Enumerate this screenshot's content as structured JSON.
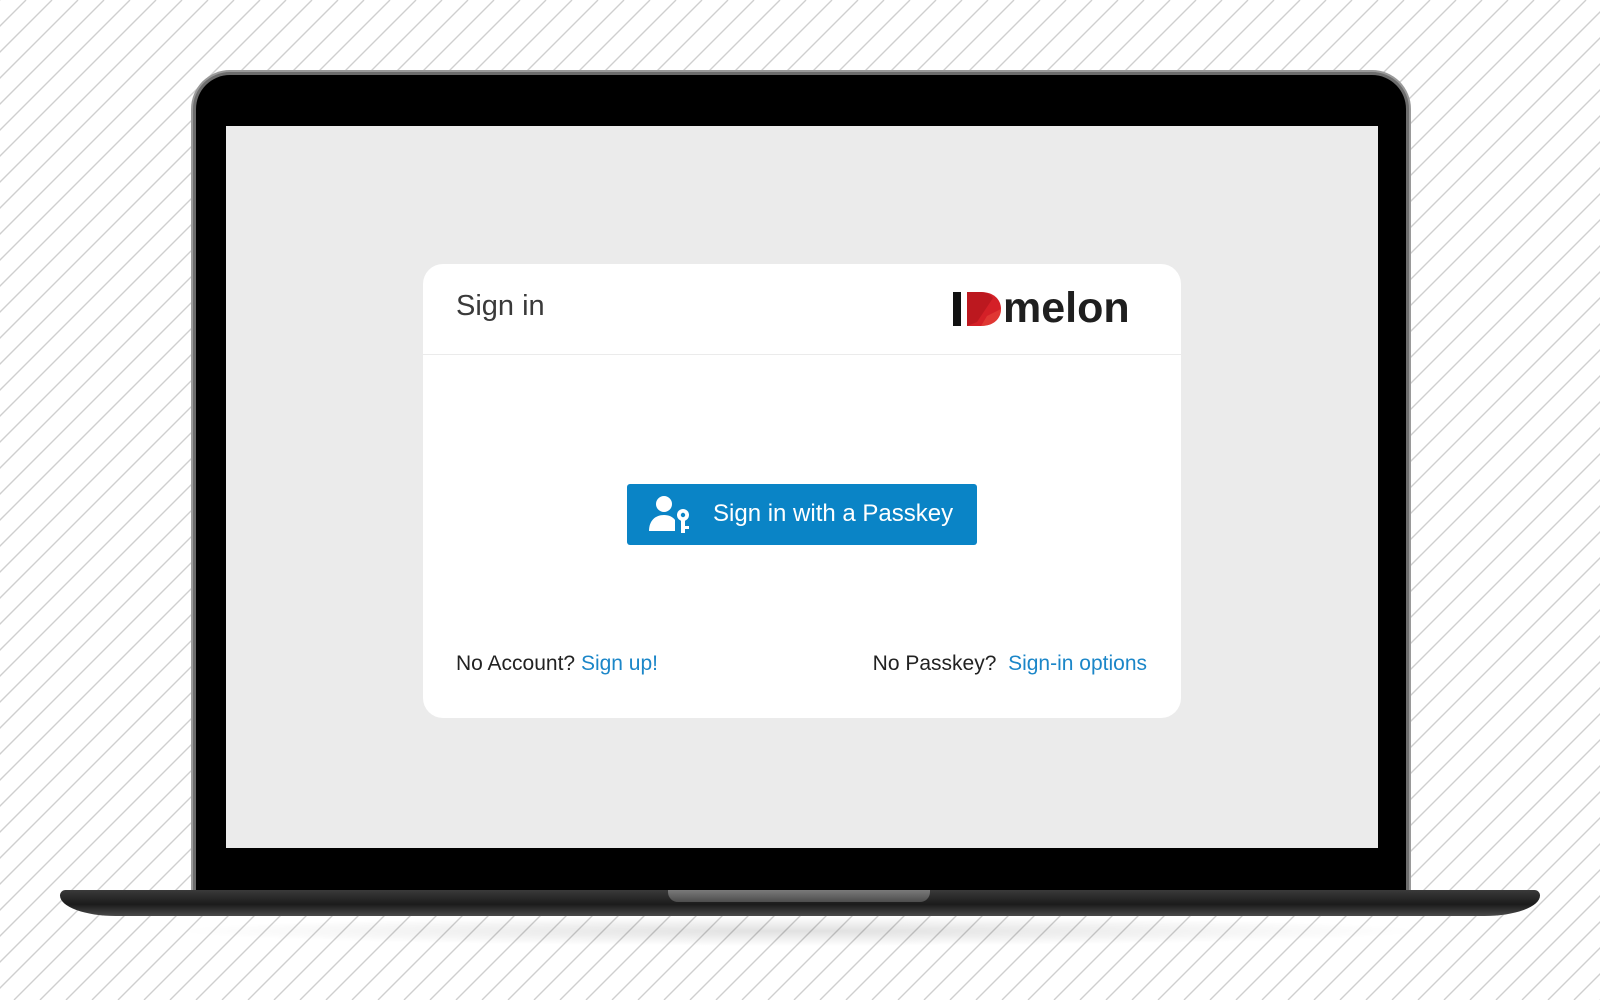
{
  "header": {
    "title": "Sign in",
    "logo_text": "melon"
  },
  "passkey_button": {
    "label": "Sign in with a Passkey",
    "icon": "user-key-icon"
  },
  "footer": {
    "no_account_text": "No Account?",
    "signup_link": "Sign up!",
    "no_passkey_text": "No Passkey?",
    "signin_options_link": "Sign-in options"
  },
  "colors": {
    "primary": "#0a84c6",
    "link": "#1b86c8",
    "logo_red": "#d42027",
    "screen_bg": "#ebebeb"
  }
}
